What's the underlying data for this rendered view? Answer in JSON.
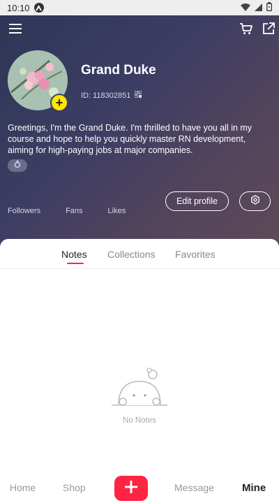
{
  "status_bar": {
    "time": "10:10",
    "app_icon": "expo-icon"
  },
  "header": {
    "menu_icon": "menu-icon",
    "cart_icon": "cart-icon",
    "share_icon": "share-icon"
  },
  "profile": {
    "name": "Grand Duke",
    "id_text": "ID: 118302851",
    "bio": "Greetings, I'm the Grand Duke. I'm thrilled to have you all in my course and hope to help you quickly master RN development, aiming for high-paying jobs at major companies.",
    "add_badge": "+",
    "gender_icon": "male-icon"
  },
  "stats": [
    {
      "label": "Followers"
    },
    {
      "label": "Fans"
    },
    {
      "label": "Likes"
    }
  ],
  "actions": {
    "edit_profile": "Edit profile",
    "settings_icon": "gear-icon"
  },
  "tabs": [
    {
      "label": "Notes",
      "active": true
    },
    {
      "label": "Collections",
      "active": false
    },
    {
      "label": "Favorites",
      "active": false
    }
  ],
  "empty_state": {
    "text": "No Notes"
  },
  "bottom_nav": {
    "home": "Home",
    "shop": "Shop",
    "message": "Message",
    "mine": "Mine"
  },
  "colors": {
    "accent": "#ff2442",
    "badge": "#ffe600"
  }
}
